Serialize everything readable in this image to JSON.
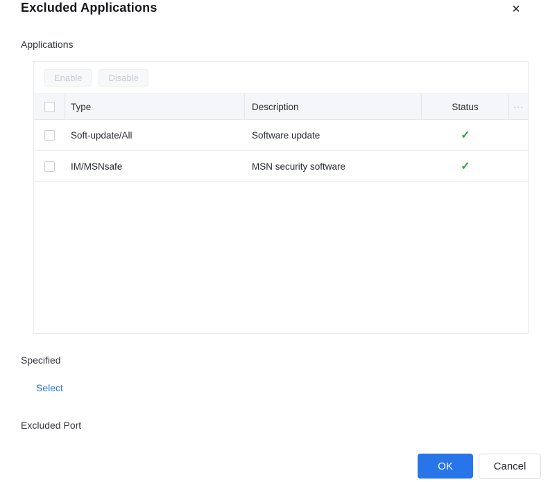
{
  "dialog": {
    "title": "Excluded Applications"
  },
  "icons": {
    "close": "✕",
    "check": "✓",
    "more": "···"
  },
  "applications": {
    "label": "Applications",
    "toolbar": {
      "enable": "Enable",
      "disable": "Disable"
    },
    "table": {
      "columns": [
        "Type",
        "Description",
        "Status"
      ],
      "rows": [
        {
          "type": "Soft-update/All",
          "description": "Software update",
          "status": "enabled"
        },
        {
          "type": "IM/MSNsafe",
          "description": "MSN security software",
          "status": "enabled"
        }
      ]
    }
  },
  "specified": {
    "label": "Specified",
    "select_link": "Select"
  },
  "excluded_port": {
    "label": "Excluded Port"
  },
  "footer": {
    "ok": "OK",
    "cancel": "Cancel"
  },
  "colors": {
    "accent_blue": "#2875ea",
    "status_green": "#2f9e44",
    "header_bg": "#f5f6f9",
    "border": "#e7eaee",
    "disabled_text": "#c4c9d4"
  }
}
